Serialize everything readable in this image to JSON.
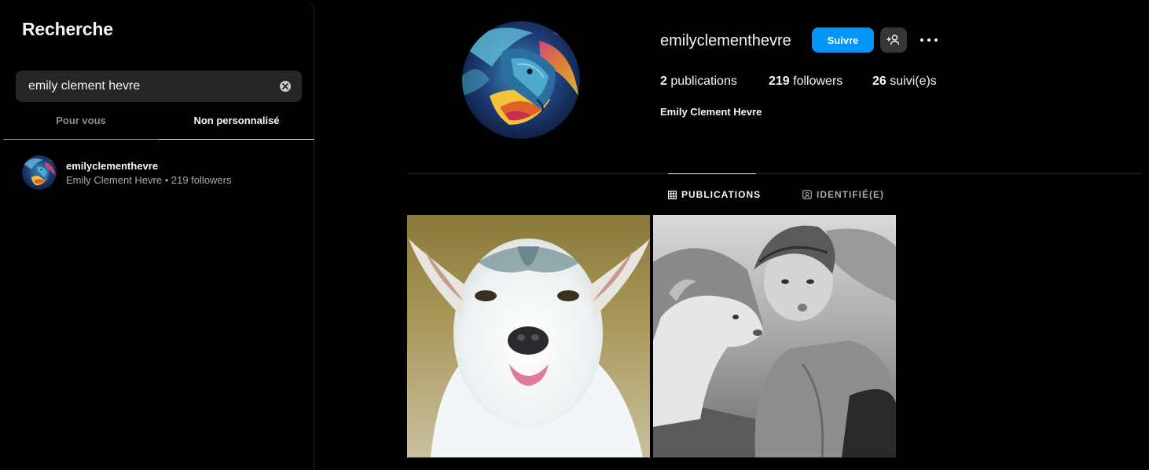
{
  "search": {
    "title": "Recherche",
    "query": "emily clement hevre",
    "tabs": [
      "Pour vous",
      "Non personnalisé"
    ],
    "active_tab": "Non personnalisé",
    "results": [
      {
        "username": "emilyclementhevre",
        "subtitle": "Emily Clement Hevre • 219 followers",
        "avatar_icon": "horse-painting-avatar"
      }
    ]
  },
  "profile": {
    "username": "emilyclementhevre",
    "follow_label": "Suivre",
    "suggest_icon": "add-person-icon",
    "more_icon": "more-options-icon",
    "stats": {
      "posts_count": "2",
      "posts_label": " publications",
      "followers_count": "219",
      "followers_label": " followers",
      "following_count": "26",
      "following_label": " suivi(e)s"
    },
    "full_name": "Emily Clement Hevre",
    "tabs": {
      "publications": "PUBLICATIONS",
      "tagged": "IDENTIFIÉ(E)"
    },
    "posts": [
      {
        "subject": "goat-kid-tongue-photo"
      },
      {
        "subject": "woman-with-goat-bw-photo"
      }
    ]
  },
  "colors": {
    "background": "#000000",
    "primary_button": "#0095f6",
    "secondary_button": "#363636",
    "muted_text": "#a8a8a8",
    "divider": "#262626"
  }
}
